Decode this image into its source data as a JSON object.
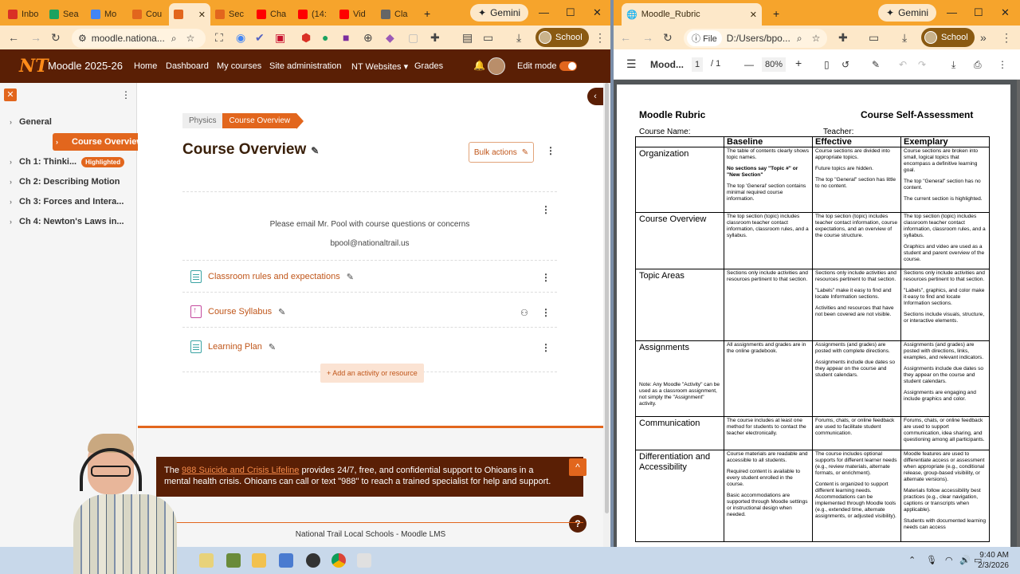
{
  "left_window": {
    "tabs": [
      {
        "label": "Inbo",
        "icon": "gmail-icon",
        "color": "#d93025"
      },
      {
        "label": "Sea",
        "icon": "drive-icon",
        "color": "#1aa260"
      },
      {
        "label": "Mo",
        "icon": "docs-icon",
        "color": "#4285f4"
      },
      {
        "label": "Cou",
        "icon": "moodle-icon",
        "color": "#e2661d"
      },
      {
        "label": "",
        "icon": "moodle-icon",
        "color": "#e2661d"
      },
      {
        "label": "Sec",
        "icon": "moodle-icon",
        "color": "#e2661d"
      },
      {
        "label": "Cha",
        "icon": "youtube-icon",
        "color": "#ff0000"
      },
      {
        "label": "(14:",
        "icon": "youtube-icon",
        "color": "#ff0000"
      },
      {
        "label": "Vid",
        "icon": "youtube-icon",
        "color": "#ff0000"
      },
      {
        "label": "Cla",
        "icon": "classroom-icon",
        "color": "#666666"
      }
    ],
    "gemini_label": "Gemini",
    "url": "moodle.nationa...",
    "profile_label": "School"
  },
  "moodle": {
    "site_name": "Moodle 2025-26",
    "nav": [
      "Home",
      "Dashboard",
      "My courses",
      "Site administration",
      "NT Websites",
      "Grades"
    ],
    "edit_mode_label": "Edit mode",
    "sidebar": [
      {
        "label": "General",
        "active": false
      },
      {
        "label": "Course Overview",
        "active": true
      },
      {
        "label": "Ch 1: Thinki...",
        "badge": "Highlighted",
        "active": false
      },
      {
        "label": "Ch 2: Describing Motion",
        "active": false
      },
      {
        "label": "Ch 3: Forces and Intera...",
        "active": false
      },
      {
        "label": "Ch 4: Newton's Laws in...",
        "active": false
      }
    ],
    "breadcrumb": [
      "Physics",
      "Course Overview"
    ],
    "page_title": "Course Overview",
    "bulk_actions_label": "Bulk actions",
    "intro_text": "Please email Mr. Pool with course questions or concerns",
    "email": "bpool@nationaltrail.us",
    "activities": [
      {
        "label": "Classroom rules and expectations",
        "icon": "page-icon"
      },
      {
        "label": "Course Syllabus",
        "icon": "file-icon"
      },
      {
        "label": "Learning Plan",
        "icon": "page-icon"
      }
    ],
    "add_activity_label": "+ Add an activity or resource",
    "banner_pre": "The",
    "banner_link": "988 Suicide and Crisis Lifeline",
    "banner_post": "provides 24/7, free, and confidential support to Ohioans in a mental health crisis. Ohioans can call or text \"988\" to reach a trained specialist for help and support.",
    "footer_text": "National Trail Local Schools - Moodle LMS",
    "accent_color": "#e2661d",
    "navbar_color": "#5a1f05"
  },
  "right_window": {
    "tab_label": "Moodle_Rubric",
    "gemini_label": "Gemini",
    "file_chip": "File",
    "path": "D:/Users/bpo...",
    "profile_label": "School",
    "pdf_title": "Mood...",
    "page_current": "1",
    "page_total": "/ 1",
    "zoom": "80%"
  },
  "rubric": {
    "title_left": "Moodle Rubric",
    "title_right": "Course Self-Assessment",
    "course_name_label": "Course Name:",
    "teacher_label": "Teacher:",
    "headers": [
      "",
      "Baseline",
      "Effective",
      "Exemplary"
    ],
    "rows": [
      {
        "category": "Organization",
        "note": "",
        "baseline": [
          "The table of contents clearly shows topic names.",
          "No sections say \"Topic #\" or \"New Section\"",
          "The top 'General' section contains minimal required course information."
        ],
        "effective": [
          "Course sections are divided into appropriate topics.",
          "Future topics are hidden.",
          "The top \"General\" section has little to no content."
        ],
        "exemplary": [
          "Course sections are broken into small, logical topics that encompass a definitive learning goal.",
          "The top \"General\" section has no content.",
          "The current section is highlighted."
        ]
      },
      {
        "category": "Course Overview",
        "note": "",
        "baseline": [
          "The top section (topic) includes classroom teacher contact information, classroom rules, and a syllabus."
        ],
        "effective": [
          "The top section (topic) includes teacher contact information, course expectations, and an overview of the course structure."
        ],
        "exemplary": [
          "The top section (topic) includes classroom teacher contact information, classroom rules, and a syllabus.",
          "Graphics and video are used as a student and parent overview of the course."
        ]
      },
      {
        "category": "Topic  Areas",
        "note": "",
        "baseline": [
          "Sections only include activities and resources pertinent to that section."
        ],
        "effective": [
          "Sections only include activities and resources pertinent to that section.",
          "\"Labels\" make it easy to find and locate Information sections.",
          "Activities and resources that have not been covered are not visible."
        ],
        "exemplary": [
          "Sections only include activities and resources pertinent to that section.",
          "\"Labels\", graphics, and color make it easy to find and locate Information sections.",
          "Sections include visuals, structure, or interactive elements."
        ]
      },
      {
        "category": "Assignments",
        "note": "Note:  Any Moodle \"Activity\" can be used as a classroom assignment, not simply the \"Assignment\" activity.",
        "baseline": [
          "All assignments and grades are in the online gradebook."
        ],
        "effective": [
          "Assignments (and grades) are posted with complete directions.",
          "Assignments include due dates so they appear on the course and student calendars."
        ],
        "exemplary": [
          "Assignments (and grades) are posted with directions, links, examples, and relevant indicators.",
          "Assignments include due dates so they appear on the course and student calendars.",
          "Assignments are engaging and include graphics and color."
        ]
      },
      {
        "category": "Communication",
        "note": "",
        "baseline": [
          "The course includes at least one method for students to contact the teacher electronically."
        ],
        "effective": [
          "Forums, chats, or online feedback are used to facilitate student communication."
        ],
        "exemplary": [
          "Forums, chats, or online feedback are used to support communication, idea sharing, and questioning among all participants."
        ]
      },
      {
        "category": "Differentiation and Accessibility",
        "note": "",
        "baseline": [
          "Course materials are readable and accessible to all students.",
          "Required content is available to every student enrolled in the course.",
          "Basic accommodations are supported through Moodle settings or instructional design when needed."
        ],
        "effective": [
          "The course includes optional supports for different learner needs (e.g., review materials, alternate formats, or enrichment).",
          "Content is organized to support different learning needs. Accommodations can be implemented through Moodle tools (e.g., extended time, alternate assignments, or adjusted visibility)."
        ],
        "exemplary": [
          "Moodle features are used to differentiate access or assessment when appropriate (e.g., conditional release, group-based visibility, or alternate versions).",
          "Materials follow accessibility best practices (e.g., clear navigation, captions or transcripts when applicable).",
          "Students with documented learning needs can access"
        ]
      }
    ]
  },
  "taskbar": {
    "time": "9:40 AM",
    "date": "2/3/2026"
  }
}
